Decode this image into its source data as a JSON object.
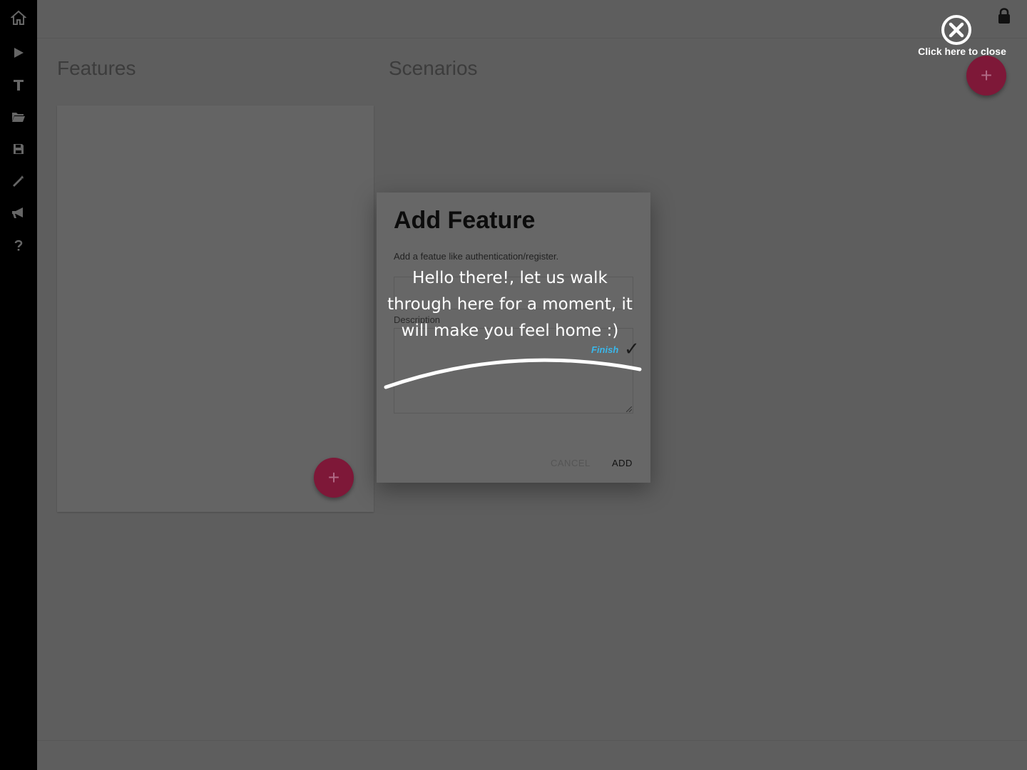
{
  "sidebar": {
    "items": [
      {
        "icon": "home-icon"
      },
      {
        "icon": "play-icon"
      },
      {
        "icon": "upload-icon"
      },
      {
        "icon": "folder-icon"
      },
      {
        "icon": "save-icon"
      },
      {
        "icon": "magic-wand-icon"
      },
      {
        "icon": "megaphone-icon"
      },
      {
        "icon": "question-icon"
      }
    ]
  },
  "header": {
    "lock_icon": "lock-icon"
  },
  "main": {
    "features_heading": "Features",
    "scenarios_heading": "Scenarios",
    "add_feature_fab": "+",
    "add_scenario_fab": "+"
  },
  "dialog": {
    "title": "Add Feature",
    "subtitle": "Add a featue like authentication/register.",
    "description_label": "Description",
    "cancel_label": "CANCEL",
    "add_label": "ADD"
  },
  "tour": {
    "message": "Hello there!, let us walk through here for a moment, it will make you feel home :)",
    "finish_label": "Finish",
    "check": "✓",
    "close_hint": "Click here to close"
  },
  "colors": {
    "fab": "#7e1838",
    "finish": "#3ab7ea",
    "backdrop": "#5e5e5e"
  }
}
